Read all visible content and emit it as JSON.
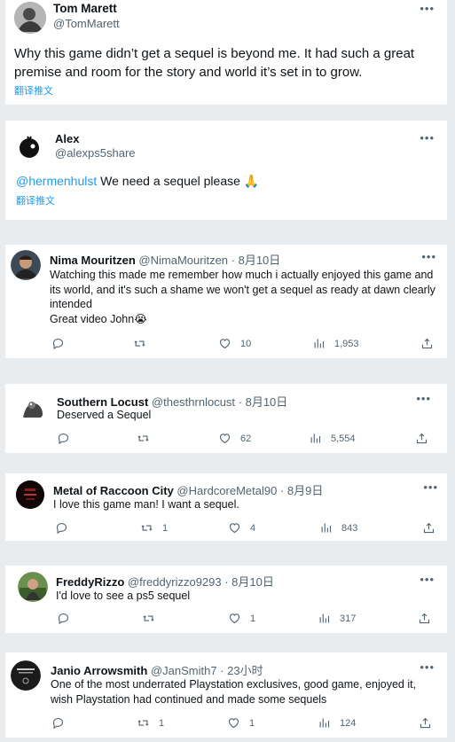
{
  "tweets": [
    {
      "author": "Tom Marett",
      "handle": "@TomMarett",
      "text": "Why this game didn’t get a sequel is beyond me. It had such a great premise and room for the story and world it’s set in to grow.",
      "translate": "翻译推文"
    },
    {
      "author": "Alex",
      "handle": "@alexps5share",
      "mention": "@hermenhulst",
      "text": " We need a sequel please 🙏",
      "translate": "翻译推文"
    },
    {
      "author": "Nima Mouritzen",
      "handle": "@NimaMouritzen · 8月10日",
      "text": "Watching this made me remember how much i actually enjoyed this game and its world, and it's such a shame we won't get a sequel as ready at dawn clearly intended\nGreat video John😭",
      "replies": "",
      "retweets": "",
      "likes": "10",
      "views": "1,953"
    },
    {
      "author": "Southern Locust",
      "handle": "@thesthrnlocust · 8月10日",
      "text": "Deserved a Sequel",
      "replies": "",
      "retweets": "",
      "likes": "62",
      "views": "5,554"
    },
    {
      "author": "Metal of Raccoon City",
      "handle": "@HardcoreMetal90 · 8月9日",
      "text": "I love this game man! I want a sequel.",
      "replies": "",
      "retweets": "1",
      "likes": "4",
      "views": "843"
    },
    {
      "author": "FreddyRizzo",
      "handle": "@freddyrizzo9293 · 8月10日",
      "text": "I'd love to see a ps5 sequel",
      "replies": "",
      "retweets": "",
      "likes": "1",
      "views": "317"
    },
    {
      "author": "Janio Arrowsmith",
      "handle": "@JanSmith7 · 23小时",
      "text": "One of the most underrated Playstation exclusives, good game, enjoyed it, wish Playstation had continued and made some sequels",
      "replies": "",
      "retweets": "1",
      "likes": "1",
      "views": "124"
    }
  ],
  "more_label": "•••",
  "colors": {
    "link": "#1d9bf0",
    "muted": "#536471",
    "background": "#e9ecef"
  },
  "icons": [
    "reply-icon",
    "retweet-icon",
    "like-icon",
    "views-icon",
    "share-icon",
    "more-icon"
  ]
}
